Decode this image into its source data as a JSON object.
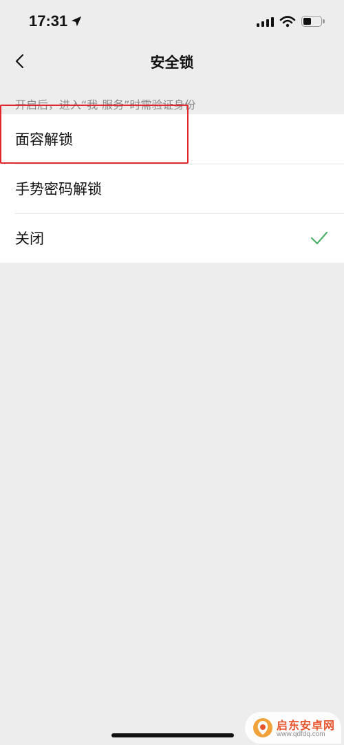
{
  "status_bar": {
    "time": "17:31",
    "battery_level": 0.45
  },
  "nav": {
    "title": "安全锁"
  },
  "hint": "开启后，进入“我-服务”时需验证身份",
  "options": [
    {
      "label": "面容解锁",
      "selected": false
    },
    {
      "label": "手势密码解锁",
      "selected": false
    },
    {
      "label": "关闭",
      "selected": true
    }
  ],
  "colors": {
    "background": "#ededed",
    "check": "#4caf68",
    "highlight": "#e1262d"
  },
  "icons": {
    "back": "chevron-left-icon",
    "check": "checkmark-icon",
    "location": "location-arrow-icon",
    "wifi": "wifi-icon",
    "signal": "cellular-signal-icon",
    "battery": "battery-icon"
  },
  "watermark": {
    "name": "启东安卓网",
    "url": "www.qdfdq.com"
  }
}
